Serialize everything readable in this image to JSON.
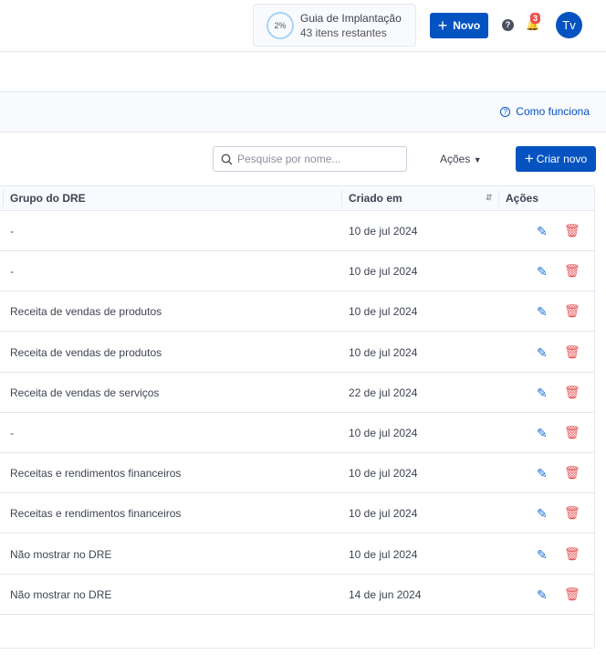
{
  "header": {
    "guide_percent": "2%",
    "guide_title": "Guia de Implantação",
    "guide_subtitle": "43 itens restantes",
    "new_button": "Novo",
    "help": "?",
    "notifications_count": "3",
    "avatar": "Tv"
  },
  "band": {
    "how_it_works": "Como funciona"
  },
  "toolbar": {
    "search_placeholder": "Pesquise por nome...",
    "actions": "Ações",
    "create_new": "Criar novo"
  },
  "table": {
    "columns": [
      "Grupo do DRE",
      "Criado em",
      "Ações"
    ],
    "rows": [
      {
        "group": "-",
        "created": "10 de jul 2024"
      },
      {
        "group": "-",
        "created": "10 de jul 2024"
      },
      {
        "group": "Receita de vendas de produtos",
        "created": "10 de jul 2024"
      },
      {
        "group": "Receita de vendas de produtos",
        "created": "10 de jul 2024"
      },
      {
        "group": "Receita de vendas de serviços",
        "created": "22 de jul 2024"
      },
      {
        "group": "-",
        "created": "10 de jul 2024"
      },
      {
        "group": "Receitas e rendimentos financeiros",
        "created": "10 de jul 2024"
      },
      {
        "group": "Receitas e rendimentos financeiros",
        "created": "10 de jul 2024"
      },
      {
        "group": "Não mostrar no DRE",
        "created": "10 de jul 2024"
      },
      {
        "group": "Não mostrar no DRE",
        "created": "14 de jun 2024"
      }
    ]
  }
}
